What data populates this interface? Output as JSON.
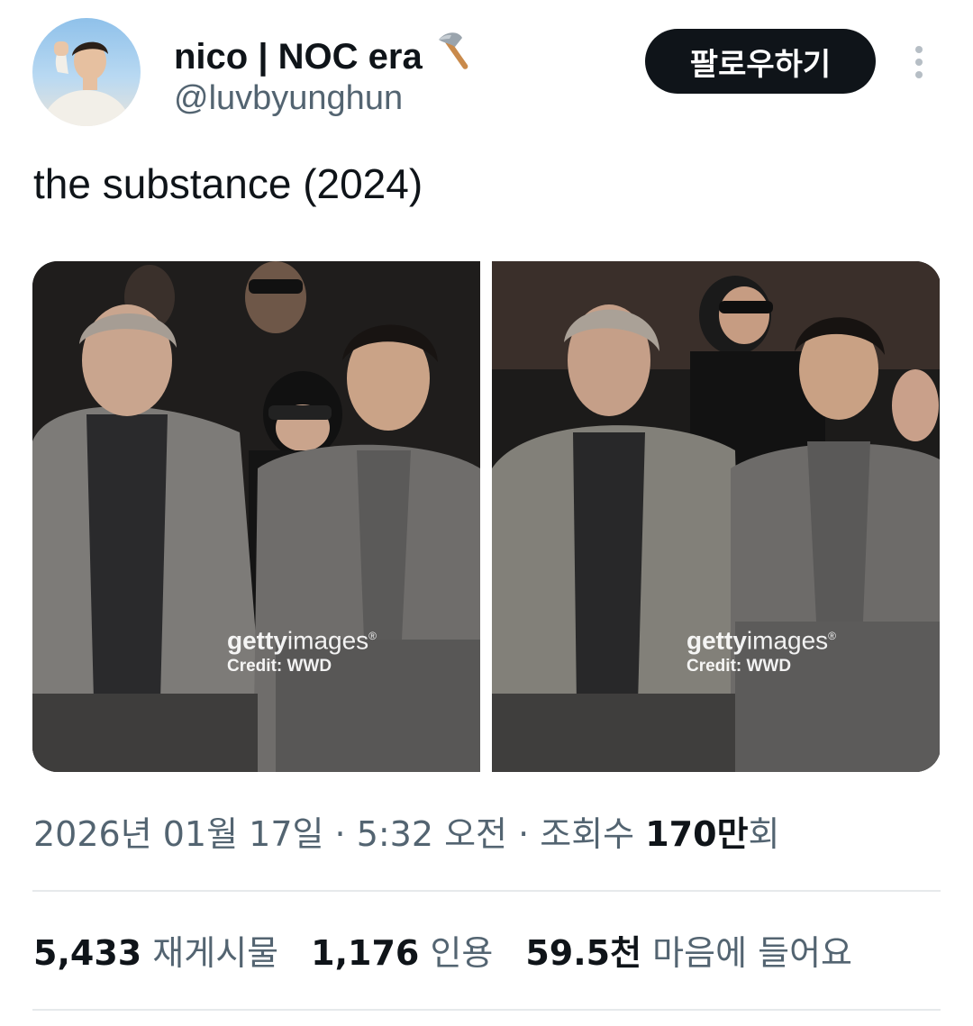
{
  "user": {
    "display_name": "nico | NOC era",
    "emoji": "🪓",
    "handle": "@luvbyunghun",
    "follow_label": "팔로우하기"
  },
  "tweet": {
    "text": "the substance (2024)"
  },
  "media": [
    {
      "watermark_brand_bold": "getty",
      "watermark_brand_light": "images",
      "watermark_reg": "®",
      "credit": "Credit: WWD"
    },
    {
      "watermark_brand_bold": "getty",
      "watermark_brand_light": "images",
      "watermark_reg": "®",
      "credit": "Credit: WWD"
    }
  ],
  "meta": {
    "datetime": "2026년 01월 17일 · 5:32 오전 · 조회수 ",
    "views_count": "170",
    "views_unit": "만",
    "views_suffix": "회"
  },
  "stats": {
    "reposts_count": "5,433",
    "reposts_label": "재게시물",
    "quotes_count": "1,176",
    "quotes_label": "인용",
    "likes_count": "59.5천",
    "likes_label": "마음에 들어요"
  },
  "colors": {
    "text_primary": "#0f1419",
    "text_secondary": "#536471",
    "divider": "#e6e9eb",
    "button_bg": "#0f1419"
  }
}
